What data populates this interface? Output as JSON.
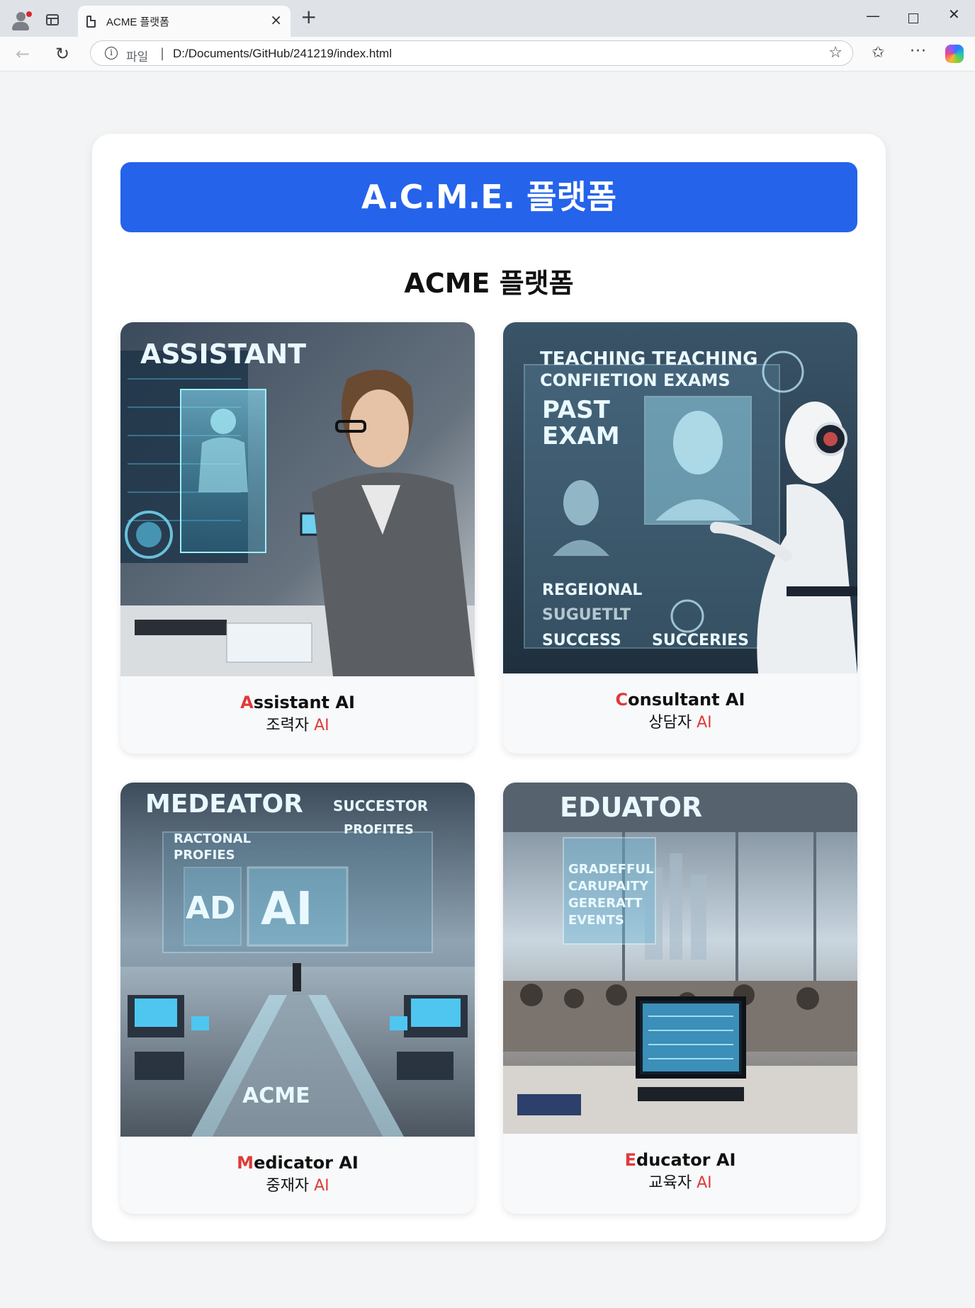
{
  "browser": {
    "tab_title": "ACME 플랫폼",
    "tab_close": "×",
    "new_tab": "+",
    "address_scheme": "파일",
    "address_separator": "|",
    "url": "D:/Documents/GitHub/241219/index.html",
    "window_controls": {
      "minimize": "—",
      "close": "✕"
    },
    "icons": [
      "profile-icon",
      "tab-actions-icon",
      "document-icon",
      "back-icon",
      "reload-icon",
      "info-icon",
      "favorite-star-icon",
      "favorites-icon",
      "more-icon",
      "copilot-icon"
    ]
  },
  "page": {
    "banner_title": "A.C.M.E. 플랫폼",
    "subtitle": "ACME 플랫폼",
    "accent_color": "#2563eb",
    "initial_color": "#e03a3a",
    "cards": [
      {
        "image_text": {
          "headline": "ASSISTANT"
        },
        "initial": "A",
        "rest": "ssistant AI",
        "ko": "조력자",
        "ko_ai": "AI"
      },
      {
        "image_text": {
          "line1": "TEACHING TEACHING",
          "line2": "CONFIETION EXAMS",
          "past": "PAST",
          "exam": "EXAM",
          "regional": "REGEIONAL",
          "sub": "SUGUETLT",
          "success": "SUCCESS",
          "succeries": "SUCCERIES"
        },
        "initial": "C",
        "rest": "onsultant AI",
        "ko": "상담자",
        "ko_ai": "AI"
      },
      {
        "image_text": {
          "headline": "MEDEATOR",
          "successor": "SUCCESTOR",
          "racional": "RACTONAL",
          "profiles_left": "PROFIES",
          "profiles_right": "PROFITES",
          "ad": "AD",
          "ai": "AI",
          "acme": "ACME"
        },
        "initial": "M",
        "rest": "edicator AI",
        "ko": "중재자",
        "ko_ai": "AI"
      },
      {
        "image_text": {
          "headline": "EDUATOR",
          "line1": "GRADEFFUL",
          "line2": "CARUPAITY",
          "line3": "GERERATT",
          "line4": "EVENTS"
        },
        "initial": "E",
        "rest": "ducator AI",
        "ko": "교육자",
        "ko_ai": "AI"
      }
    ]
  }
}
